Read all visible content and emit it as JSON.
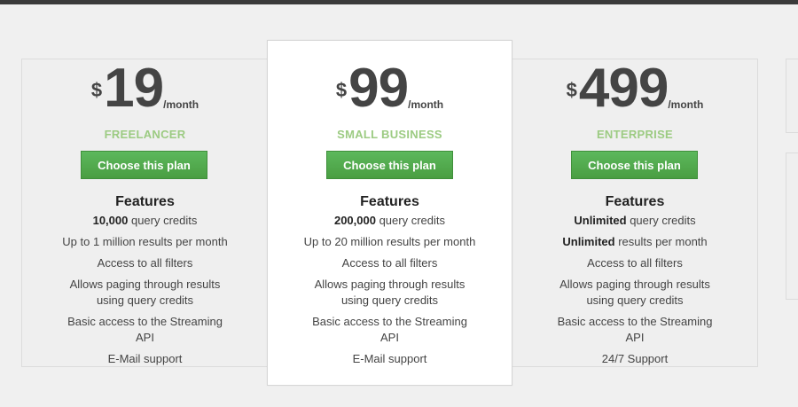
{
  "plans": [
    {
      "currency": "$",
      "price": "19",
      "period": "/month",
      "name": "FREELANCER",
      "button_label": "Choose this plan",
      "features_title": "Features",
      "features": [
        {
          "bold": "10,000",
          "text": " query credits"
        },
        {
          "bold": "",
          "text": "Up to 1 million results per month"
        },
        {
          "bold": "",
          "text": "Access to all filters"
        },
        {
          "bold": "",
          "text": "Allows paging through results using query credits"
        },
        {
          "bold": "",
          "text": "Basic access to the Streaming API"
        },
        {
          "bold": "",
          "text": "E-Mail support"
        }
      ]
    },
    {
      "currency": "$",
      "price": "99",
      "period": "/month",
      "name": "SMALL BUSINESS",
      "button_label": "Choose this plan",
      "features_title": "Features",
      "features": [
        {
          "bold": "200,000",
          "text": " query credits"
        },
        {
          "bold": "",
          "text": "Up to 20 million results per month"
        },
        {
          "bold": "",
          "text": "Access to all filters"
        },
        {
          "bold": "",
          "text": "Allows paging through results using query credits"
        },
        {
          "bold": "",
          "text": "Basic access to the Streaming API"
        },
        {
          "bold": "",
          "text": "E-Mail support"
        }
      ]
    },
    {
      "currency": "$",
      "price": "499",
      "period": "/month",
      "name": "ENTERPRISE",
      "button_label": "Choose this plan",
      "features_title": "Features",
      "features": [
        {
          "bold": "Unlimited",
          "text": " query credits"
        },
        {
          "bold": "Unlimited",
          "text": " results per month"
        },
        {
          "bold": "",
          "text": "Access to all filters"
        },
        {
          "bold": "",
          "text": "Allows paging through results using query credits"
        },
        {
          "bold": "",
          "text": "Basic access to the Streaming API"
        },
        {
          "bold": "",
          "text": "24/7 Support"
        }
      ]
    }
  ],
  "colors": {
    "plan_name": "#9ccb82",
    "button": "#4cae4c",
    "featured_card": "#ffffff",
    "card": "#efefef",
    "background": "#f0f0f0"
  }
}
